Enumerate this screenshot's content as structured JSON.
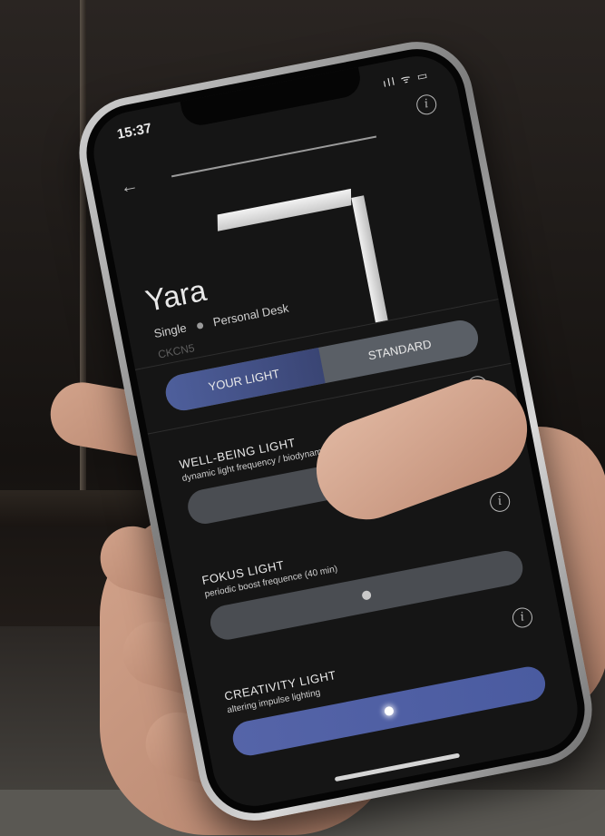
{
  "status": {
    "time": "15:37",
    "signal": "ıll ᯤ ▭"
  },
  "header": {
    "back_icon": "arrow-left-icon",
    "info_icon": "info-icon",
    "info_glyph": "i"
  },
  "product": {
    "name": "Yara",
    "variant": "Single",
    "category": "Personal Desk",
    "code": "CKCN5"
  },
  "mode_toggle": {
    "left": "YOUR LIGHT",
    "right": "STANDARD",
    "selected": "YOUR LIGHT"
  },
  "sections": [
    {
      "title": "WELL-BEING LIGHT",
      "description": "dynamic light frequency / biodynamic light (VtL)",
      "active": false
    },
    {
      "title": "FOKUS LIGHT",
      "description": "periodic boost frequence (40 min)",
      "active": false
    },
    {
      "title": "CREATIVITY LIGHT",
      "description": "altering impulse lighting",
      "active": true
    }
  ],
  "colors": {
    "accent": "#4e5f9c",
    "inactive_bar": "#4a4d52",
    "screen_bg": "#151515"
  }
}
